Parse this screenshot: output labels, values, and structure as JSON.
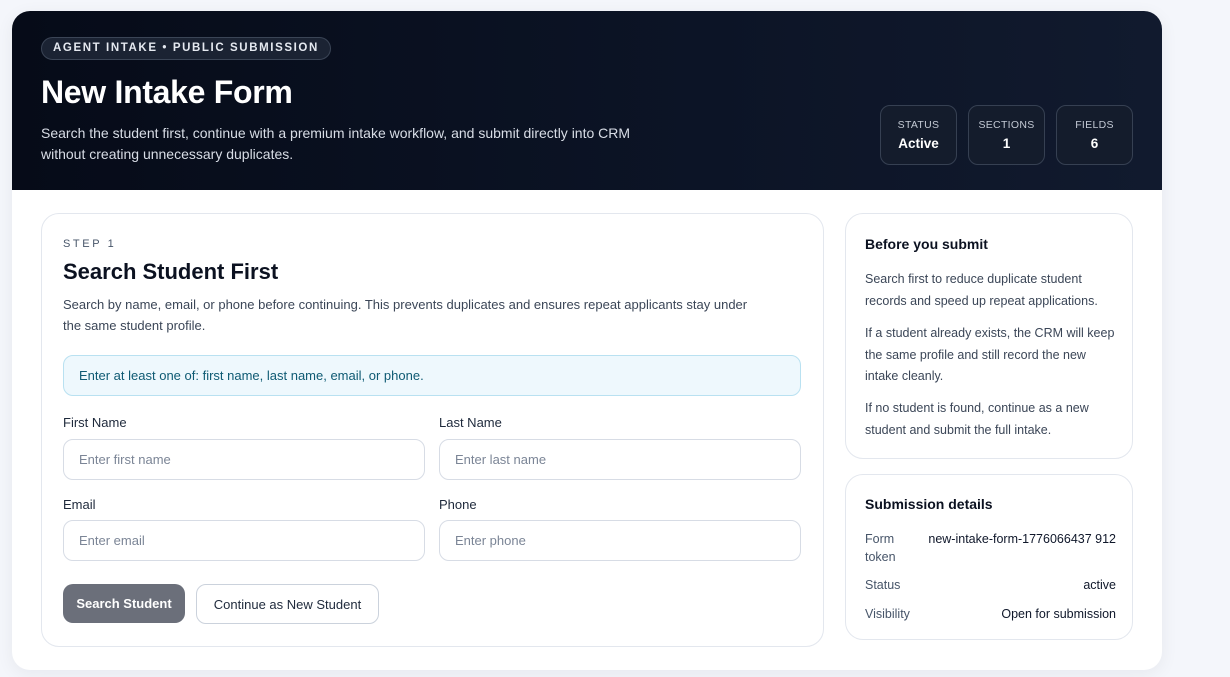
{
  "hero": {
    "eyebrow": "AGENT INTAKE • PUBLIC SUBMISSION",
    "title": "New Intake Form",
    "description": "Search the student first, continue with a premium intake workflow, and submit directly into CRM without creating unnecessary duplicates.",
    "stats": [
      {
        "label": "STATUS",
        "value": "Active"
      },
      {
        "label": "SECTIONS",
        "value": "1"
      },
      {
        "label": "FIELDS",
        "value": "6"
      }
    ]
  },
  "main": {
    "step": "STEP 1",
    "title": "Search Student First",
    "description": "Search by name, email, or phone before continuing. This prevents duplicates and ensures repeat applicants stay under the same student profile.",
    "notice": "Enter at least one of: first name, last name, email, or phone.",
    "fields": {
      "first_name": {
        "label": "First Name",
        "placeholder": "Enter first name",
        "value": ""
      },
      "last_name": {
        "label": "Last Name",
        "placeholder": "Enter last name",
        "value": ""
      },
      "email": {
        "label": "Email",
        "placeholder": "Enter email",
        "value": ""
      },
      "phone": {
        "label": "Phone",
        "placeholder": "Enter phone",
        "value": ""
      }
    },
    "search_button": "Search Student",
    "continue_button": "Continue as New Student"
  },
  "before_submit": {
    "title": "Before you submit",
    "paragraphs": [
      "Search first to reduce duplicate student records and speed up repeat applications.",
      "If a student already exists, the CRM will keep the same profile and still record the new intake cleanly.",
      "If no student is found, continue as a new student and submit the full intake."
    ]
  },
  "submission_details": {
    "title": "Submission details",
    "rows": [
      {
        "key": "Form token",
        "value": "new-intake-form-1776066437 912"
      },
      {
        "key": "Status",
        "value": "active"
      },
      {
        "key": "Visibility",
        "value": "Open for submission"
      }
    ]
  }
}
